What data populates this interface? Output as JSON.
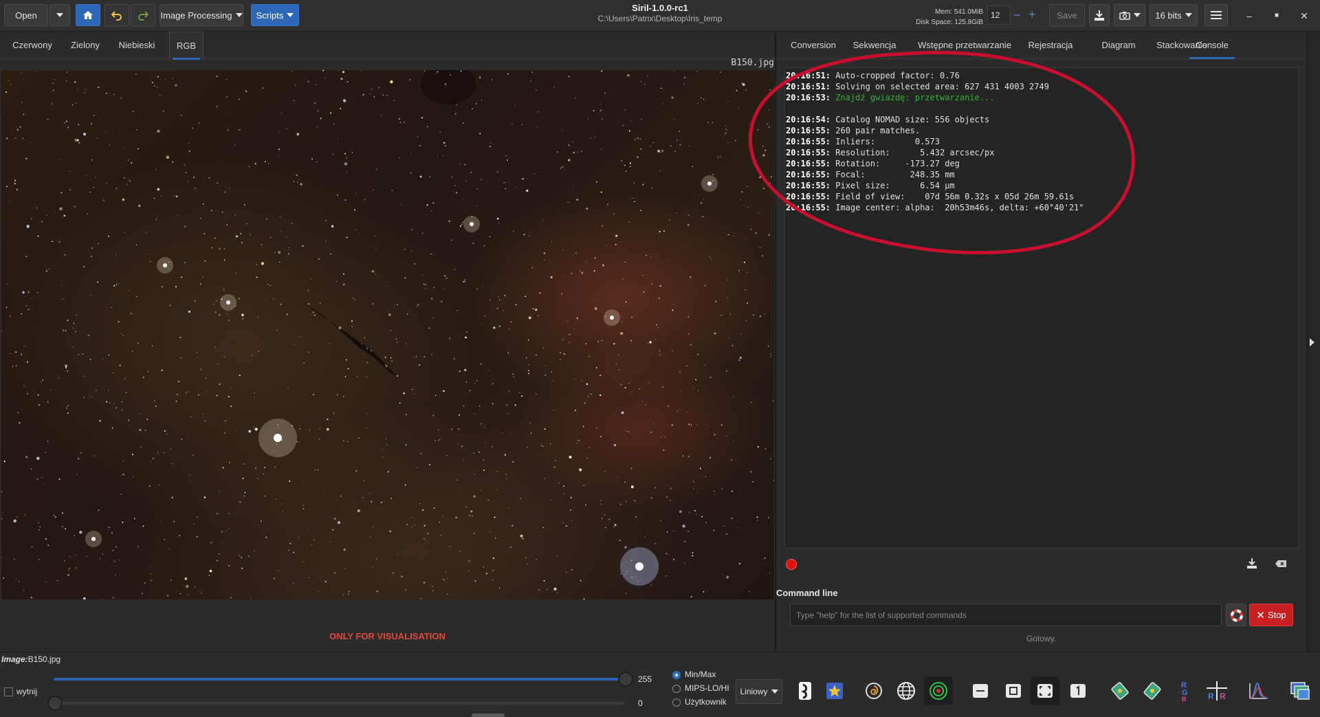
{
  "header": {
    "open_label": "Open",
    "image_processing_label": "Image Processing",
    "scripts_label": "Scripts",
    "title": "Siril-1.0.0-rc1",
    "path": "C:\\Users\\Patrix\\Desktop\\Iris_temp",
    "mem": "Mem: 541.0MiB",
    "disk": "Disk Space: 125.8GiB",
    "threads_value": "12",
    "save_label": "Save",
    "bitdepth_label": "16 bits"
  },
  "left_tabs": [
    "Czerwony",
    "Zielony",
    "Niebieski",
    "RGB"
  ],
  "active_left_tab": "RGB",
  "filename": "B150.jpg",
  "visualisation_note": "ONLY FOR VISUALISATION",
  "right_tabs": [
    "Conversion",
    "Sekwencja",
    "Wstępne przetwarzanie",
    "Rejestracja",
    "Diagram",
    "Stackowanie",
    "Console"
  ],
  "active_right_tab": "Console",
  "console_lines": [
    {
      "time": "20:16:51:",
      "text": " Auto-cropped factor: 0.76",
      "color": "normal"
    },
    {
      "time": "20:16:51:",
      "text": " Solving on selected area: 627 431 4003 2749",
      "color": "normal"
    },
    {
      "time": "20:16:53:",
      "text": " Znajdź gwiazdę: przetwarzanie...",
      "color": "green"
    },
    {
      "time": "",
      "text": "",
      "color": "normal"
    },
    {
      "time": "20:16:54:",
      "text": " Catalog NOMAD size: 556 objects",
      "color": "normal"
    },
    {
      "time": "20:16:55:",
      "text": " 260 pair matches.",
      "color": "normal"
    },
    {
      "time": "20:16:55:",
      "text": " Inliers:        0.573",
      "color": "normal"
    },
    {
      "time": "20:16:55:",
      "text": " Resolution:      5.432 arcsec/px",
      "color": "normal"
    },
    {
      "time": "20:16:55:",
      "text": " Rotation:     -173.27 deg",
      "color": "normal"
    },
    {
      "time": "20:16:55:",
      "text": " Focal:         248.35 mm",
      "color": "normal"
    },
    {
      "time": "20:16:55:",
      "text": " Pixel size:      6.54 µm",
      "color": "normal"
    },
    {
      "time": "20:16:55:",
      "text": " Field of view:    07d 56m 0.32s x 05d 26m 59.61s",
      "color": "normal"
    },
    {
      "time": "20:16:55:",
      "text": " Image center: alpha:  20h53m46s, delta: +60°40'21\"",
      "color": "normal"
    }
  ],
  "command": {
    "label": "Command line",
    "placeholder": "Type \"help\" for the list of supported commands",
    "stop_label": "Stop",
    "status": "Gotowy."
  },
  "bottom": {
    "image_label": "Image:",
    "image_name": "B150.jpg",
    "crop_label": "wytnij",
    "hi_value": "255",
    "lo_value": "0",
    "hi_fraction": 1.0,
    "lo_fraction": 0.0,
    "radio_options": [
      "Min/Max",
      "MIPS-LO/HI",
      "Użytkownik"
    ],
    "radio_selected": "Min/Max",
    "mode_label": "Liniowy"
  },
  "colors": {
    "accent": "#2d67b6",
    "stop": "#c82020",
    "console_green": "#35b335",
    "annotation_red": "#c8102e"
  },
  "tool_icons": [
    "negative-icon",
    "star-icon",
    "galaxy-icon",
    "globe-icon",
    "target-icon",
    "minimize-icon",
    "crop-icon",
    "focus-icon",
    "duplicate-icon",
    "rotate-left-icon",
    "rotate-right-icon",
    "rgb-align-icon",
    "split-channels-icon",
    "histogram-icon",
    "multi-window-icon"
  ]
}
